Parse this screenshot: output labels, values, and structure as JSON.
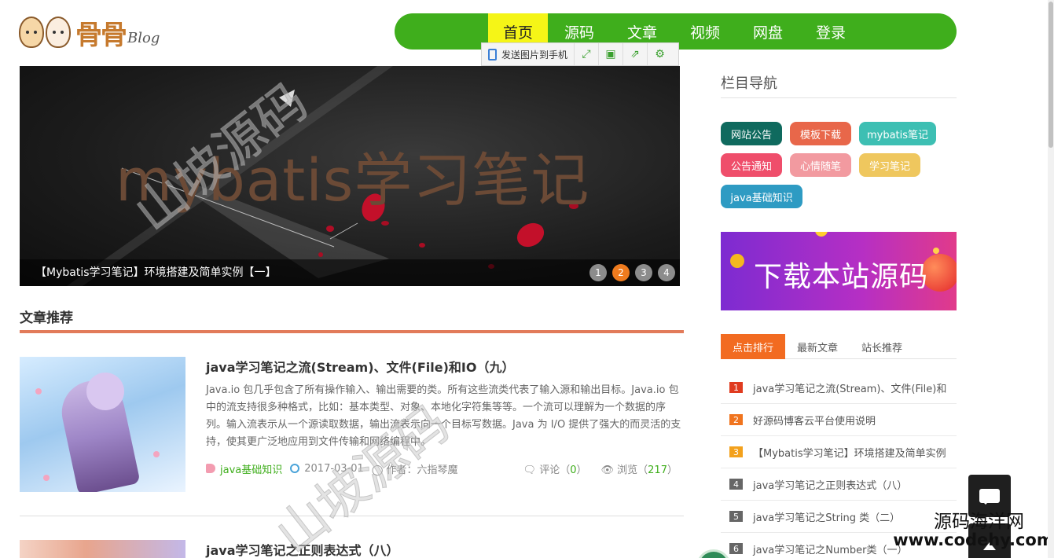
{
  "logo": {
    "brand": "骨骨",
    "suffix": "Blog"
  },
  "nav": {
    "items": [
      "首页",
      "源码",
      "文章",
      "视频",
      "网盘",
      "登录"
    ],
    "active": "首页"
  },
  "image_toolbar": {
    "send_label": "发送图片到手机"
  },
  "banner": {
    "big_title": "mybatis学习笔记",
    "caption": "【Mybatis学习笔记】环境搭建及简单实例【一】",
    "dots": [
      "1",
      "2",
      "3",
      "4"
    ],
    "active_dot": "2"
  },
  "watermark": "山坡源码",
  "section": {
    "title": "文章推荐"
  },
  "articles": [
    {
      "title": "java学习笔记之流(Stream)、文件(File)和IO（九）",
      "summary": "Java.io 包几乎包含了所有操作输入、输出需要的类。所有这些流类代表了输入源和输出目标。Java.io 包中的流支持很多种格式，比如：基本类型、对象、本地化字符集等等。一个流可以理解为一个数据的序列。输入流表示从一个源读取数据，输出流表示向一个目标写数据。Java 为 I/O 提供了强大的而灵活的支持，使其更广泛地应用到文件传输和网络编程中。",
      "tag": "java基础知识",
      "date": "2017-03-01",
      "author": "作者：六指琴魔",
      "comments_label": "评论（",
      "comments": "0",
      "comments_end": "）",
      "views_label": "浏览（",
      "views": "217",
      "views_end": "）"
    },
    {
      "title": "java学习笔记之正则表达式（八）"
    }
  ],
  "sidebar": {
    "nav_title": "栏目导航",
    "tags": [
      {
        "label": "网站公告",
        "color": "#0f6a5e"
      },
      {
        "label": "模板下载",
        "color": "#e8674a"
      },
      {
        "label": "mybatis笔记",
        "color": "#3dbfb3"
      },
      {
        "label": "公告通知",
        "color": "#ef4e6b"
      },
      {
        "label": "心情随笔",
        "color": "#f29aa0"
      },
      {
        "label": "学习笔记",
        "color": "#efc75e"
      },
      {
        "label": "java基础知识",
        "color": "#2e9bc3"
      }
    ],
    "ad_text": "下载本站源码",
    "rank_tabs": [
      "点击排行",
      "最新文章",
      "站长推荐"
    ],
    "rank_items": [
      {
        "num": "1",
        "color": "#e03b1f",
        "title": "java学习笔记之流(Stream)、文件(File)和"
      },
      {
        "num": "2",
        "color": "#f0741e",
        "title": "好源码博客云平台使用说明"
      },
      {
        "num": "3",
        "color": "#f3a11c",
        "title": "【Mybatis学习笔记】环境搭建及简单实例"
      },
      {
        "num": "4",
        "color": "#666666",
        "title": "java学习笔记之正则表达式（八）"
      },
      {
        "num": "5",
        "color": "#666666",
        "title": "java学习笔记之String 类（二）"
      },
      {
        "num": "6",
        "color": "#666666",
        "title": "java学习笔记之Number类（一）"
      }
    ]
  },
  "site_watermark": {
    "line1": "源码海洋网",
    "line2": "www.codehy.com"
  }
}
